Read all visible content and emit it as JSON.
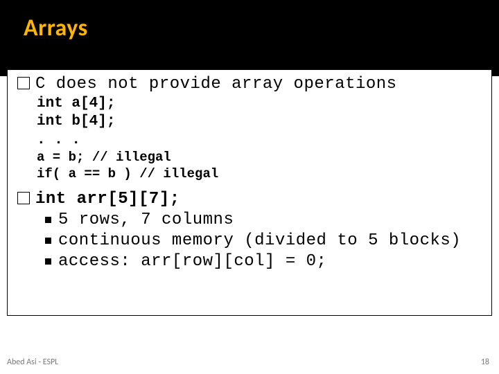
{
  "header": {
    "title": "Arrays"
  },
  "block1": {
    "lead": "C does not provide array operations",
    "lines": [
      "int a[4];",
      "int b[4];",
      ". . .",
      "a = b; // illegal",
      "if( a == b ) // illegal"
    ]
  },
  "block2": {
    "lead": "int arr[5][7];",
    "bullets": [
      "5 rows, 7 columns",
      "continuous memory (divided to 5 blocks)",
      "access: arr[row][col] = 0;"
    ]
  },
  "footer": {
    "author": "Abed Asi - ESPL",
    "page": "18"
  }
}
